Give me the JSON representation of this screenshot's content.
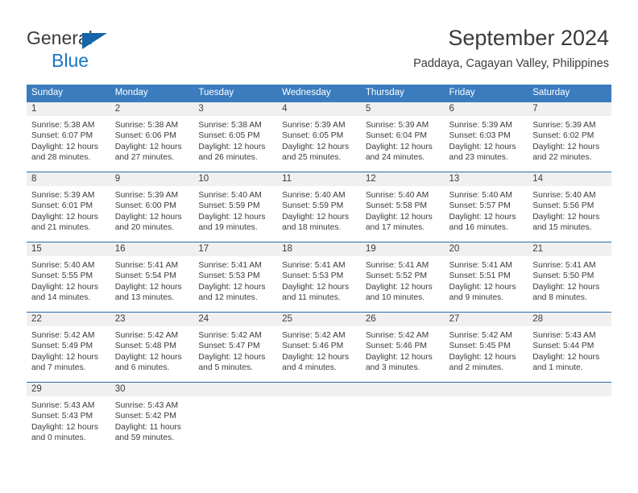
{
  "brand": {
    "name_part1": "General",
    "name_part2": "Blue",
    "logo_icon": "triangle-icon",
    "color_primary": "#1b77c4",
    "color_triangle": "#1565a8"
  },
  "header": {
    "title": "September 2024",
    "subtitle": "Paddaya, Cagayan Valley, Philippines"
  },
  "calendar": {
    "header_bg": "#3a7cbe",
    "row_divider": "#2b6cad",
    "daynum_bg": "#f0f0f0",
    "weekday_headers": [
      "Sunday",
      "Monday",
      "Tuesday",
      "Wednesday",
      "Thursday",
      "Friday",
      "Saturday"
    ],
    "weeks": [
      [
        {
          "day": "1",
          "sunrise": "Sunrise: 5:38 AM",
          "sunset": "Sunset: 6:07 PM",
          "daylight1": "Daylight: 12 hours",
          "daylight2": "and 28 minutes."
        },
        {
          "day": "2",
          "sunrise": "Sunrise: 5:38 AM",
          "sunset": "Sunset: 6:06 PM",
          "daylight1": "Daylight: 12 hours",
          "daylight2": "and 27 minutes."
        },
        {
          "day": "3",
          "sunrise": "Sunrise: 5:38 AM",
          "sunset": "Sunset: 6:05 PM",
          "daylight1": "Daylight: 12 hours",
          "daylight2": "and 26 minutes."
        },
        {
          "day": "4",
          "sunrise": "Sunrise: 5:39 AM",
          "sunset": "Sunset: 6:05 PM",
          "daylight1": "Daylight: 12 hours",
          "daylight2": "and 25 minutes."
        },
        {
          "day": "5",
          "sunrise": "Sunrise: 5:39 AM",
          "sunset": "Sunset: 6:04 PM",
          "daylight1": "Daylight: 12 hours",
          "daylight2": "and 24 minutes."
        },
        {
          "day": "6",
          "sunrise": "Sunrise: 5:39 AM",
          "sunset": "Sunset: 6:03 PM",
          "daylight1": "Daylight: 12 hours",
          "daylight2": "and 23 minutes."
        },
        {
          "day": "7",
          "sunrise": "Sunrise: 5:39 AM",
          "sunset": "Sunset: 6:02 PM",
          "daylight1": "Daylight: 12 hours",
          "daylight2": "and 22 minutes."
        }
      ],
      [
        {
          "day": "8",
          "sunrise": "Sunrise: 5:39 AM",
          "sunset": "Sunset: 6:01 PM",
          "daylight1": "Daylight: 12 hours",
          "daylight2": "and 21 minutes."
        },
        {
          "day": "9",
          "sunrise": "Sunrise: 5:39 AM",
          "sunset": "Sunset: 6:00 PM",
          "daylight1": "Daylight: 12 hours",
          "daylight2": "and 20 minutes."
        },
        {
          "day": "10",
          "sunrise": "Sunrise: 5:40 AM",
          "sunset": "Sunset: 5:59 PM",
          "daylight1": "Daylight: 12 hours",
          "daylight2": "and 19 minutes."
        },
        {
          "day": "11",
          "sunrise": "Sunrise: 5:40 AM",
          "sunset": "Sunset: 5:59 PM",
          "daylight1": "Daylight: 12 hours",
          "daylight2": "and 18 minutes."
        },
        {
          "day": "12",
          "sunrise": "Sunrise: 5:40 AM",
          "sunset": "Sunset: 5:58 PM",
          "daylight1": "Daylight: 12 hours",
          "daylight2": "and 17 minutes."
        },
        {
          "day": "13",
          "sunrise": "Sunrise: 5:40 AM",
          "sunset": "Sunset: 5:57 PM",
          "daylight1": "Daylight: 12 hours",
          "daylight2": "and 16 minutes."
        },
        {
          "day": "14",
          "sunrise": "Sunrise: 5:40 AM",
          "sunset": "Sunset: 5:56 PM",
          "daylight1": "Daylight: 12 hours",
          "daylight2": "and 15 minutes."
        }
      ],
      [
        {
          "day": "15",
          "sunrise": "Sunrise: 5:40 AM",
          "sunset": "Sunset: 5:55 PM",
          "daylight1": "Daylight: 12 hours",
          "daylight2": "and 14 minutes."
        },
        {
          "day": "16",
          "sunrise": "Sunrise: 5:41 AM",
          "sunset": "Sunset: 5:54 PM",
          "daylight1": "Daylight: 12 hours",
          "daylight2": "and 13 minutes."
        },
        {
          "day": "17",
          "sunrise": "Sunrise: 5:41 AM",
          "sunset": "Sunset: 5:53 PM",
          "daylight1": "Daylight: 12 hours",
          "daylight2": "and 12 minutes."
        },
        {
          "day": "18",
          "sunrise": "Sunrise: 5:41 AM",
          "sunset": "Sunset: 5:53 PM",
          "daylight1": "Daylight: 12 hours",
          "daylight2": "and 11 minutes."
        },
        {
          "day": "19",
          "sunrise": "Sunrise: 5:41 AM",
          "sunset": "Sunset: 5:52 PM",
          "daylight1": "Daylight: 12 hours",
          "daylight2": "and 10 minutes."
        },
        {
          "day": "20",
          "sunrise": "Sunrise: 5:41 AM",
          "sunset": "Sunset: 5:51 PM",
          "daylight1": "Daylight: 12 hours",
          "daylight2": "and 9 minutes."
        },
        {
          "day": "21",
          "sunrise": "Sunrise: 5:41 AM",
          "sunset": "Sunset: 5:50 PM",
          "daylight1": "Daylight: 12 hours",
          "daylight2": "and 8 minutes."
        }
      ],
      [
        {
          "day": "22",
          "sunrise": "Sunrise: 5:42 AM",
          "sunset": "Sunset: 5:49 PM",
          "daylight1": "Daylight: 12 hours",
          "daylight2": "and 7 minutes."
        },
        {
          "day": "23",
          "sunrise": "Sunrise: 5:42 AM",
          "sunset": "Sunset: 5:48 PM",
          "daylight1": "Daylight: 12 hours",
          "daylight2": "and 6 minutes."
        },
        {
          "day": "24",
          "sunrise": "Sunrise: 5:42 AM",
          "sunset": "Sunset: 5:47 PM",
          "daylight1": "Daylight: 12 hours",
          "daylight2": "and 5 minutes."
        },
        {
          "day": "25",
          "sunrise": "Sunrise: 5:42 AM",
          "sunset": "Sunset: 5:46 PM",
          "daylight1": "Daylight: 12 hours",
          "daylight2": "and 4 minutes."
        },
        {
          "day": "26",
          "sunrise": "Sunrise: 5:42 AM",
          "sunset": "Sunset: 5:46 PM",
          "daylight1": "Daylight: 12 hours",
          "daylight2": "and 3 minutes."
        },
        {
          "day": "27",
          "sunrise": "Sunrise: 5:42 AM",
          "sunset": "Sunset: 5:45 PM",
          "daylight1": "Daylight: 12 hours",
          "daylight2": "and 2 minutes."
        },
        {
          "day": "28",
          "sunrise": "Sunrise: 5:43 AM",
          "sunset": "Sunset: 5:44 PM",
          "daylight1": "Daylight: 12 hours",
          "daylight2": "and 1 minute."
        }
      ],
      [
        {
          "day": "29",
          "sunrise": "Sunrise: 5:43 AM",
          "sunset": "Sunset: 5:43 PM",
          "daylight1": "Daylight: 12 hours",
          "daylight2": "and 0 minutes."
        },
        {
          "day": "30",
          "sunrise": "Sunrise: 5:43 AM",
          "sunset": "Sunset: 5:42 PM",
          "daylight1": "Daylight: 11 hours",
          "daylight2": "and 59 minutes."
        },
        {
          "day": "",
          "sunrise": "",
          "sunset": "",
          "daylight1": "",
          "daylight2": ""
        },
        {
          "day": "",
          "sunrise": "",
          "sunset": "",
          "daylight1": "",
          "daylight2": ""
        },
        {
          "day": "",
          "sunrise": "",
          "sunset": "",
          "daylight1": "",
          "daylight2": ""
        },
        {
          "day": "",
          "sunrise": "",
          "sunset": "",
          "daylight1": "",
          "daylight2": ""
        },
        {
          "day": "",
          "sunrise": "",
          "sunset": "",
          "daylight1": "",
          "daylight2": ""
        }
      ]
    ]
  }
}
